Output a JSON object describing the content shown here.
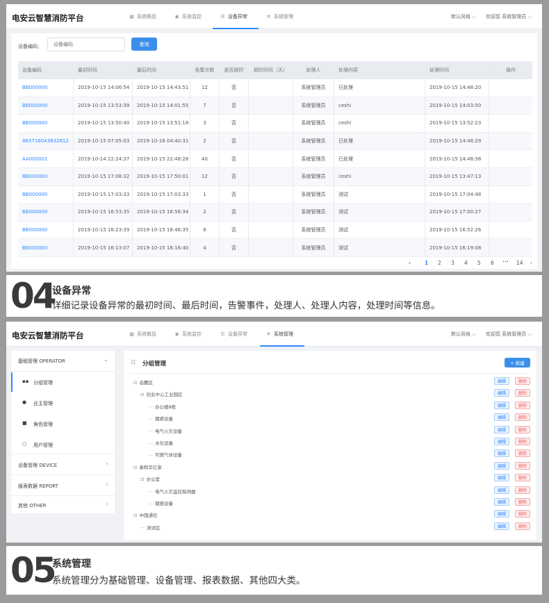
{
  "top": {
    "logo": "电安云智慧消防平台",
    "nav": [
      {
        "icon": "calendar-icon",
        "label": "系统概括"
      },
      {
        "icon": "eye-icon",
        "label": "系统监控"
      },
      {
        "icon": "sliders-icon",
        "label": "设备异常"
      },
      {
        "icon": "gear-icon",
        "label": "系统管理"
      }
    ],
    "style_label": "默认风格",
    "welcome": "欢迎您",
    "user": "系统管理员",
    "search_label": "设备编码：",
    "search_placeholder": "设备编码",
    "search_button": "查询",
    "columns": [
      "设备编码",
      "最初时间",
      "最后时间",
      "告警次数",
      "是否超时",
      "超时时间（天）",
      "处理人",
      "处理内容",
      "处理时间",
      "操作"
    ],
    "rows": [
      [
        "BB000000",
        "2019-10-15 14:06:54",
        "2019-10-15 14:43:51",
        "12",
        "否",
        "",
        "系统管理员",
        "已处理",
        "2019-10-15 14:48:20",
        ""
      ],
      [
        "BB000000",
        "2019-10-15 13:53:39",
        "2019-10-15 14:01:55",
        "7",
        "否",
        "",
        "系统管理员",
        "ceshi",
        "2019-10-15 14:03:50",
        ""
      ],
      [
        "BB000000",
        "2019-10-15 13:50:40",
        "2019-10-15 13:51:18",
        "3",
        "否",
        "",
        "系统管理员",
        "ceshi",
        "2019-10-15 13:52:23",
        ""
      ],
      [
        "863716043832812",
        "2019-10-15 07:05:03",
        "2019-10-16 04:40:31",
        "2",
        "否",
        "",
        "系统管理员",
        "已处理",
        "2019-10-15 14:48:29",
        ""
      ],
      [
        "AA000001",
        "2019-10-14 22:24:37",
        "2019-10-15 22:48:28",
        "40",
        "否",
        "",
        "系统管理员",
        "已处理",
        "2019-10-15 14:48:38",
        ""
      ],
      [
        "BB000000",
        "2019-10-15 17:08:32",
        "2019-10-15 17:50:01",
        "12",
        "否",
        "",
        "系统管理员",
        "ceshi",
        "2019-10-15 13:47:13",
        ""
      ],
      [
        "BB000000",
        "2019-10-15 17:03:33",
        "2019-10-15 17:03:33",
        "1",
        "否",
        "",
        "系统管理员",
        "测试",
        "2019-10-15 17:04:48",
        ""
      ],
      [
        "BB000000",
        "2019-10-15 16:53:35",
        "2019-10-15 16:56:34",
        "2",
        "否",
        "",
        "系统管理员",
        "测试",
        "2019-10-15 17:00:27",
        ""
      ],
      [
        "BB000000",
        "2019-10-15 16:23:39",
        "2019-10-15 16:46:35",
        "6",
        "否",
        "",
        "系统管理员",
        "测试",
        "2019-10-15 16:52:26",
        ""
      ],
      [
        "BB000000",
        "2019-10-15 16:13:07",
        "2019-10-15 16:16:40",
        "4",
        "否",
        "",
        "系统管理员",
        "测试",
        "2019-10-15 16:19:08",
        ""
      ]
    ],
    "pager": {
      "prev": "‹",
      "pages": [
        "1",
        "2",
        "3",
        "4",
        "5",
        "6"
      ],
      "ellipsis": "•••",
      "last": "14",
      "next": "›"
    }
  },
  "cap1": {
    "num": "04",
    "title": "设备异常",
    "desc": "详细记录设备异常的最初时间、最后时间，告警事件，处理人、处理人内容，处理时间等信息。"
  },
  "bottom": {
    "logo": "电安云智慧消防平台",
    "nav": [
      {
        "icon": "calendar-icon",
        "label": "系统概括"
      },
      {
        "icon": "eye-icon",
        "label": "系统监控"
      },
      {
        "icon": "sliders-icon",
        "label": "设备异常"
      },
      {
        "icon": "gear-icon",
        "label": "系统管理"
      }
    ],
    "style_label": "默认风格",
    "welcome": "欢迎您",
    "user": "系统管理员",
    "sidebar": {
      "group1": "基础管理 OPERATOR",
      "items": [
        {
          "icon": "grid-icon",
          "label": "分组管理"
        },
        {
          "icon": "person-icon",
          "label": "业主管理"
        },
        {
          "icon": "lock-icon",
          "label": "角色管理"
        },
        {
          "icon": "user-icon",
          "label": "用户管理"
        }
      ],
      "groups": [
        "设备管理 DEVICE",
        "报表数据 REPORT",
        "其他 OTHER"
      ]
    },
    "panel_title": "分组管理",
    "add_button": "+ 新建",
    "tree": [
      {
        "label": "岳麓区",
        "toggle": "⊟",
        "level": 0
      },
      {
        "label": "创业中心工业园区",
        "toggle": "⊟",
        "level": 1
      },
      {
        "label": "办公楼8栋",
        "toggle": "",
        "level": 2
      },
      {
        "label": "烟感设备",
        "toggle": "",
        "level": 2
      },
      {
        "label": "电气火灾设备",
        "toggle": "",
        "level": 2
      },
      {
        "label": "水位设备",
        "toggle": "",
        "level": 2
      },
      {
        "label": "可燃气体设备",
        "toggle": "",
        "level": 2
      },
      {
        "label": "泰和华亿家",
        "toggle": "⊟",
        "level": 0
      },
      {
        "label": "办公室",
        "toggle": "⊟",
        "level": 1
      },
      {
        "label": "电气火灾监控探测器",
        "toggle": "",
        "level": 2
      },
      {
        "label": "烟感设备",
        "toggle": "",
        "level": 2
      },
      {
        "label": "中国通信",
        "toggle": "⊟",
        "level": 0
      },
      {
        "label": "测试区",
        "toggle": "",
        "level": 1
      }
    ],
    "edit_label": "编辑",
    "delete_label": "删除"
  },
  "cap2": {
    "num": "05",
    "title": "系统管理",
    "desc": "系统管理分为基础管理、设备管理、报表数据、其他四大类。"
  }
}
